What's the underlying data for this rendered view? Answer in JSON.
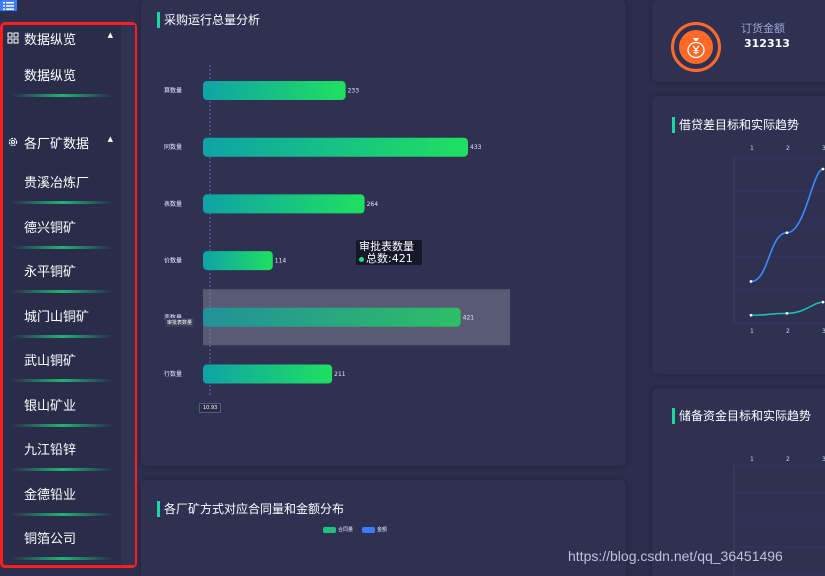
{
  "sidebar": {
    "groups": [
      {
        "label": "数据纵览",
        "icon": "grid-icon",
        "items": [
          "数据纵览"
        ]
      },
      {
        "label": "各厂矿数据",
        "icon": "gear-icon",
        "items": [
          "贵溪冶炼厂",
          "德兴铜矿",
          "永平铜矿",
          "城门山铜矿",
          "武山铜矿",
          "银山矿业",
          "九江铅锌",
          "金德铅业",
          "铜箔公司"
        ]
      }
    ]
  },
  "panels": {
    "procurement_title": "采购运行总量分析",
    "distribution_title": "各厂矿方式对应合同量和金额分布",
    "credit_title": "借贷差目标和实际趋势",
    "reserve_title": "储备资金目标和实际趋势"
  },
  "order": {
    "label": "订货金额",
    "value": "312313"
  },
  "tooltip": {
    "title": "审批表数量",
    "row_label": "总数",
    "row_value": "421"
  },
  "axis_pointer": {
    "y_label": "审批表数量",
    "x_label": "10.93"
  },
  "legend": [
    "合同量",
    "金额"
  ],
  "chart_data": [
    {
      "type": "bar",
      "orientation": "horizontal",
      "categories": [
        "算数量",
        "同数量",
        "表数量",
        "价数量",
        "审批表数量",
        "行数量"
      ],
      "tick_labels": [
        "算数量",
        "同数量",
        "表数量",
        "价数量",
        "表数量",
        "行数量"
      ],
      "values": [
        233,
        433,
        264,
        114,
        421,
        211
      ],
      "highlighted_index": 4,
      "colors": [
        "#0fa3a6",
        "#1fe060"
      ]
    },
    {
      "type": "line",
      "x": [
        1,
        2,
        3
      ],
      "series": [
        {
          "values": [
            1.0,
            2.3,
            4.0
          ],
          "color": "#3b8cff"
        },
        {
          "values": [
            0.1,
            0.15,
            0.45
          ],
          "color": "#1fbfb0"
        }
      ]
    },
    {
      "type": "line",
      "x": [
        1,
        2,
        3
      ],
      "series": []
    }
  ],
  "watermark": "https://blog.csdn.net/qq_36451496"
}
